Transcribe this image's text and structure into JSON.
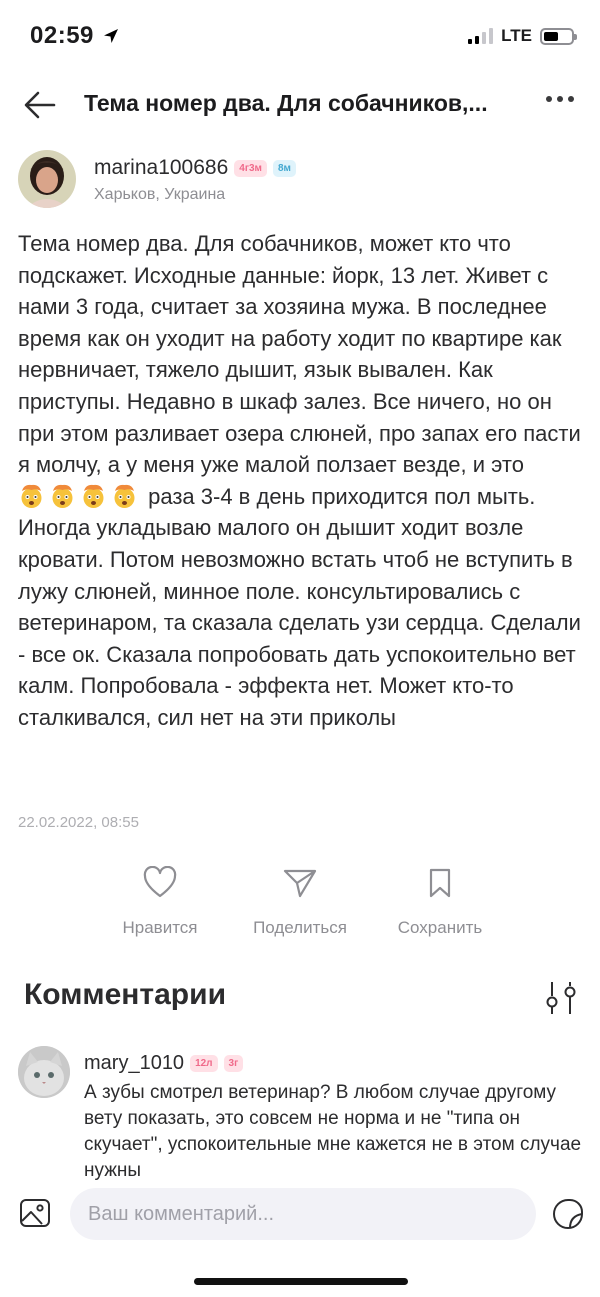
{
  "status_bar": {
    "time": "02:59",
    "network": "LTE"
  },
  "header": {
    "title": "Тема номер два. Для собачников,..."
  },
  "author": {
    "name": "marina100686",
    "badges": [
      "4г3м",
      "8м"
    ],
    "location": "Харьков, Украина"
  },
  "post": {
    "text_part1": "Тема номер два. Для собачников, может кто что подскажет. Исходные данные: йорк, 13 лет. Живет с нами 3 года, считает за хозяина мужа. В последнее время как он уходит на работу ходит по квартире как нервничает, тяжело дышит, язык вывален. Как приступы. Недавно в шкаф залез. Все ничего, но он при этом разливает озера слюней, про запах его пасти я молчу, а у меня уже малой ползает везде, и это",
    "emojis": [
      "exploding-head",
      "exploding-head",
      "exploding-head",
      "exploding-head"
    ],
    "text_part2": " раза 3-4 в день приходится пол мыть. Иногда укладываю малого он дышит ходит возле кровати. Потом невозможно встать чтоб не вступить в лужу слюней, минное поле. консультировались с ветеринаром, та сказала сделать узи сердца. Сделали - все ок. Сказала попробовать дать успокоительно вет калм. Попробовала - эффекта нет. Может кто-то сталкивался, сил нет на эти приколы",
    "date": "22.02.2022, 08:55"
  },
  "actions": {
    "like_label": "Нравится",
    "share_label": "Поделиться",
    "save_label": "Сохранить"
  },
  "comments": {
    "title": "Комментарии",
    "items": [
      {
        "author": "mary_1010",
        "badges": [
          "12л",
          "3г"
        ],
        "text": "А зубы смотрел ветеринар? В любом случае другому вету показать, это совсем не норма и не \"типа он скучает\", успокоительные мне кажется не в этом случае нужны"
      }
    ]
  },
  "input": {
    "placeholder": "Ваш комментарий..."
  },
  "colors": {
    "accent_pink": "#f06a8a",
    "accent_blue": "#43a8d0",
    "muted": "#8e8e93"
  }
}
